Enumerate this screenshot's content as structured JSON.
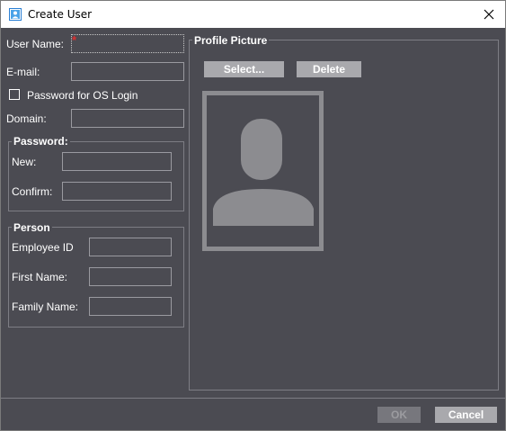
{
  "window": {
    "title": "Create User",
    "icon": "user-app-icon",
    "close_icon": "close-icon"
  },
  "form": {
    "user_name_label": "User Name:",
    "user_name_value": "",
    "email_label": "E-mail:",
    "email_value": "",
    "os_login_label": "Password for OS Login",
    "os_login_checked": false,
    "domain_label": "Domain:",
    "domain_value": ""
  },
  "password": {
    "title": "Password:",
    "new_label": "New:",
    "new_value": "",
    "confirm_label": "Confirm:",
    "confirm_value": ""
  },
  "person": {
    "title": "Person",
    "employee_id_label": "Employee ID",
    "employee_id_value": "",
    "first_name_label": "First Name:",
    "first_name_value": "",
    "family_name_label": "Family Name:",
    "family_name_value": ""
  },
  "profile_picture": {
    "title": "Profile Picture",
    "select_label": "Select...",
    "delete_label": "Delete",
    "placeholder_icon": "user-silhouette-icon"
  },
  "footer": {
    "ok_label": "OK",
    "cancel_label": "Cancel"
  },
  "colors": {
    "background": "#4b4b52",
    "button": "#a9a9ad",
    "silhouette": "#8c8c90",
    "required": "#e03030"
  }
}
